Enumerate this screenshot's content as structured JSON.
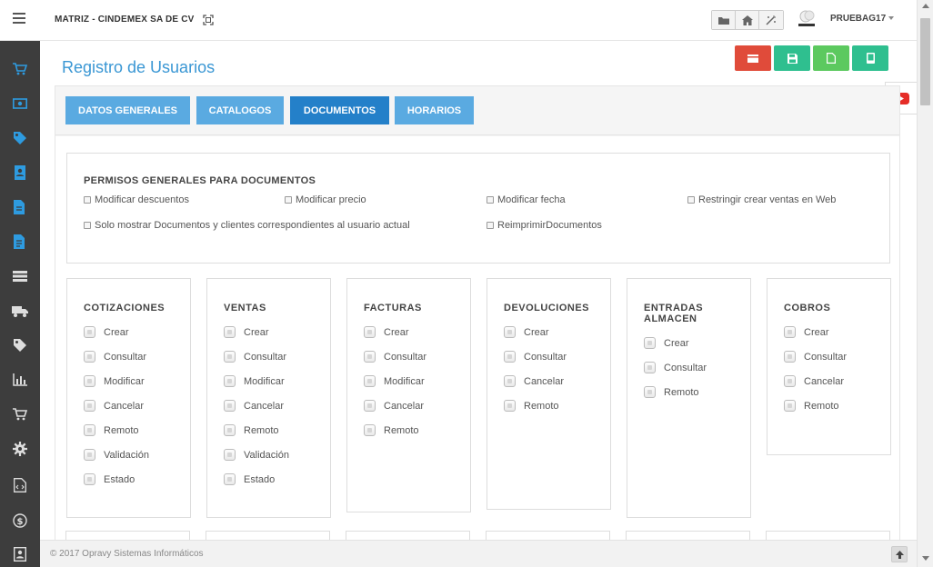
{
  "header": {
    "company": "MATRIZ - CINDEMEX SA DE CV",
    "username": "PRUEBAG17"
  },
  "sidebar": {
    "icons": [
      "cart-icon",
      "money-icon",
      "tag-icon",
      "address-book-icon",
      "file-edit-icon",
      "file-text-icon",
      "list-icon",
      "truck-icon",
      "tags-icon",
      "bar-chart-icon",
      "shopping-cart-icon",
      "gear-icon",
      "code-file-icon",
      "dollar-icon",
      "contact-card-icon"
    ]
  },
  "page": {
    "title": "Registro de Usuarios"
  },
  "tabs": [
    "DATOS GENERALES",
    "CATALOGOS",
    "DOCUMENTOS",
    "HORARIOS"
  ],
  "active_tab": "DOCUMENTOS",
  "permisos_generales": {
    "title": "PERMISOS GENERALES PARA DOCUMENTOS",
    "items": [
      "Modificar descuentos",
      "Modificar precio",
      "Modificar fecha",
      "Restringir crear ventas en Web",
      "Solo mostrar Documentos y clientes correspondientes al usuario actual",
      "ReimprimirDocumentos"
    ]
  },
  "cards": [
    {
      "title": "COTIZACIONES",
      "options": [
        "Crear",
        "Consultar",
        "Modificar",
        "Cancelar",
        "Remoto",
        "Validación",
        "Estado"
      ]
    },
    {
      "title": "VENTAS",
      "options": [
        "Crear",
        "Consultar",
        "Modificar",
        "Cancelar",
        "Remoto",
        "Validación",
        "Estado"
      ]
    },
    {
      "title": "FACTURAS",
      "options": [
        "Crear",
        "Consultar",
        "Modificar",
        "Cancelar",
        "Remoto"
      ]
    },
    {
      "title": "DEVOLUCIONES",
      "options": [
        "Crear",
        "Consultar",
        "Cancelar",
        "Remoto"
      ]
    },
    {
      "title": "ENTRADAS ALMACEN",
      "options": [
        "Crear",
        "Consultar",
        "Remoto"
      ]
    },
    {
      "title": "COBROS",
      "options": [
        "Crear",
        "Consultar",
        "Cancelar",
        "Remoto"
      ]
    }
  ],
  "footer": {
    "text": "© 2017 Opravy Sistemas Informáticos"
  },
  "colors": {
    "accent": "#3a97d4",
    "tab": "#5aaae1",
    "tab_active": "#2480c9",
    "sidebar": "#3d3d3d",
    "btn_red": "#e04b3a",
    "btn_teal": "#2fbf8f",
    "btn_green": "#5cc95f"
  }
}
